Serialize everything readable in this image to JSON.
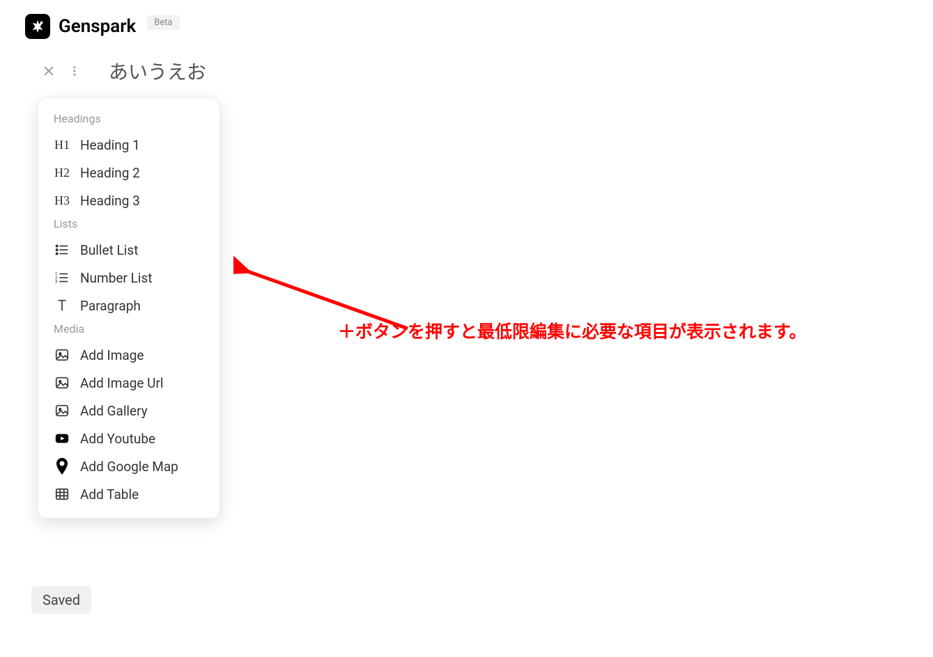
{
  "header": {
    "brand": "Genspark",
    "badge": "Beta"
  },
  "document": {
    "title": "あいうえお"
  },
  "menu": {
    "sections": [
      {
        "label": "Headings",
        "items": [
          {
            "icon": "H1",
            "label": "Heading 1",
            "name": "heading-1"
          },
          {
            "icon": "H2",
            "label": "Heading 2",
            "name": "heading-2"
          },
          {
            "icon": "H3",
            "label": "Heading 3",
            "name": "heading-3"
          }
        ]
      },
      {
        "label": "Lists",
        "items": [
          {
            "icon": "bullet",
            "label": "Bullet List",
            "name": "bullet-list"
          },
          {
            "icon": "numbered",
            "label": "Number List",
            "name": "number-list"
          },
          {
            "icon": "paragraph",
            "label": "Paragraph",
            "name": "paragraph"
          }
        ]
      },
      {
        "label": "Media",
        "items": [
          {
            "icon": "image",
            "label": "Add Image",
            "name": "add-image"
          },
          {
            "icon": "image",
            "label": "Add Image Url",
            "name": "add-image-url"
          },
          {
            "icon": "image",
            "label": "Add Gallery",
            "name": "add-gallery"
          },
          {
            "icon": "youtube",
            "label": "Add Youtube",
            "name": "add-youtube"
          },
          {
            "icon": "map",
            "label": "Add Google Map",
            "name": "add-google-map"
          },
          {
            "icon": "table",
            "label": "Add Table",
            "name": "add-table"
          }
        ]
      }
    ]
  },
  "annotation": "＋ボタンを押すと最低限編集に必要な項目が表示されます。",
  "status": "Saved"
}
